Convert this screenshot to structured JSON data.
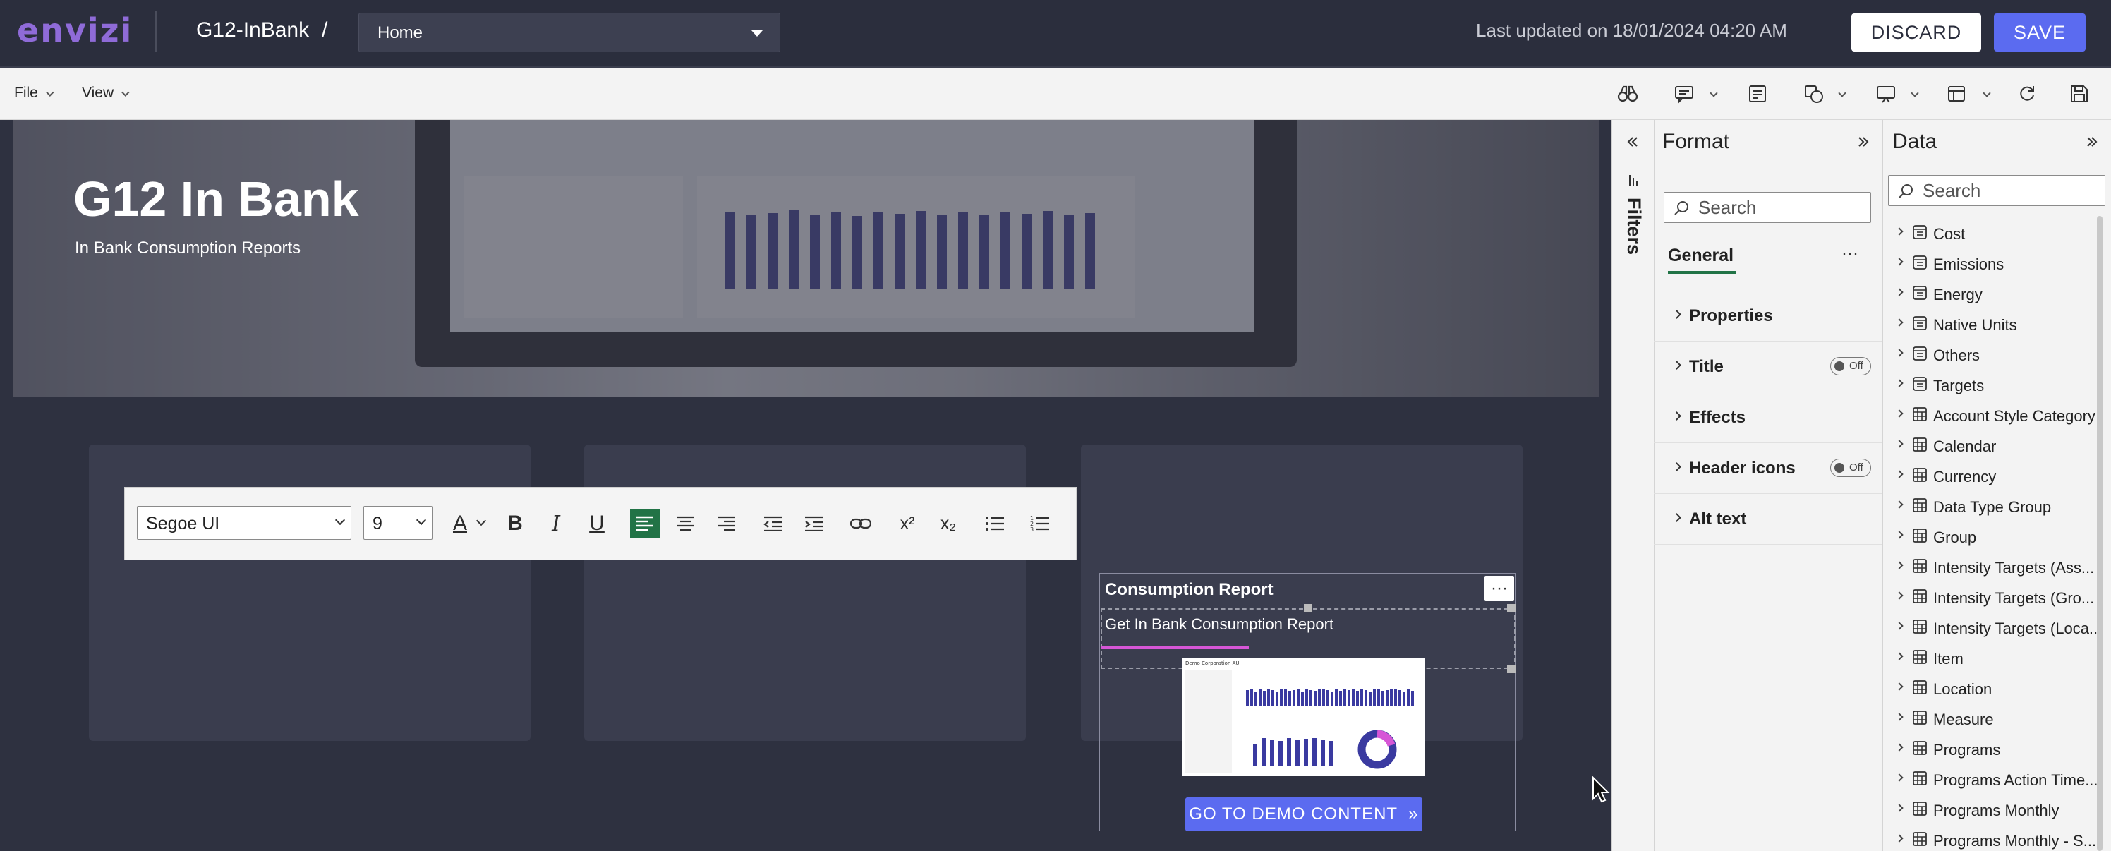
{
  "header": {
    "logo_text": "envizi",
    "report_name": "G12-InBank",
    "separator": "/",
    "page_select": "Home",
    "last_updated": "Last updated on 18/01/2024 04:20 AM",
    "discard_label": "DISCARD",
    "save_label": "SAVE",
    "save_color": "#5b6bf0"
  },
  "ribbon": {
    "menus": [
      "File",
      "View"
    ],
    "icons": [
      "binoculars-icon",
      "comment-icon",
      "notes-icon",
      "shapes-icon",
      "present-icon",
      "layout-icon",
      "refresh-icon",
      "save-icon"
    ]
  },
  "canvas": {
    "hero_title": "G12 In Bank",
    "hero_subtitle": "In Bank Consumption Reports",
    "text_toolbar": {
      "font": "Segoe UI",
      "size": "9",
      "font_color_glyph": "A",
      "bold": "B",
      "italic": "I",
      "underline": "U",
      "superscript": "x²",
      "subscript": "x₂",
      "align_active": "left",
      "active_color": "#217346"
    },
    "consumption_card": {
      "title": "Consumption Report",
      "more": "···",
      "body_text": "Get In Bank Consumption Report",
      "button_label": "GO TO DEMO CONTENT",
      "button_icon": "double-chevron-right-icon"
    }
  },
  "filters": {
    "label": "Filters"
  },
  "format_pane": {
    "title": "Format",
    "search_placeholder": "Search",
    "tab": "General",
    "tab_more": "···",
    "sections": [
      {
        "label": "Properties",
        "toggle": ""
      },
      {
        "label": "Title",
        "toggle": "Off"
      },
      {
        "label": "Effects",
        "toggle": ""
      },
      {
        "label": "Header icons",
        "toggle": "Off"
      },
      {
        "label": "Alt text",
        "toggle": ""
      }
    ]
  },
  "data_pane": {
    "title": "Data",
    "search_placeholder": "Search",
    "items": [
      {
        "label": "Cost",
        "kind": "measure-table"
      },
      {
        "label": "Emissions",
        "kind": "measure-table"
      },
      {
        "label": "Energy",
        "kind": "measure-table"
      },
      {
        "label": "Native Units",
        "kind": "measure-table"
      },
      {
        "label": "Others",
        "kind": "measure-table"
      },
      {
        "label": "Targets",
        "kind": "measure-table"
      },
      {
        "label": "Account Style Category",
        "kind": "table"
      },
      {
        "label": "Calendar",
        "kind": "table"
      },
      {
        "label": "Currency",
        "kind": "table"
      },
      {
        "label": "Data Type Group",
        "kind": "table"
      },
      {
        "label": "Group",
        "kind": "table"
      },
      {
        "label": "Intensity Targets (Ass...",
        "kind": "table"
      },
      {
        "label": "Intensity Targets (Gro...",
        "kind": "table"
      },
      {
        "label": "Intensity Targets (Loca...",
        "kind": "table"
      },
      {
        "label": "Item",
        "kind": "table"
      },
      {
        "label": "Location",
        "kind": "table"
      },
      {
        "label": "Measure",
        "kind": "table"
      },
      {
        "label": "Programs",
        "kind": "table"
      },
      {
        "label": "Programs Action Time...",
        "kind": "table"
      },
      {
        "label": "Programs Monthly",
        "kind": "table"
      },
      {
        "label": "Programs Monthly - S...",
        "kind": "table"
      }
    ]
  }
}
